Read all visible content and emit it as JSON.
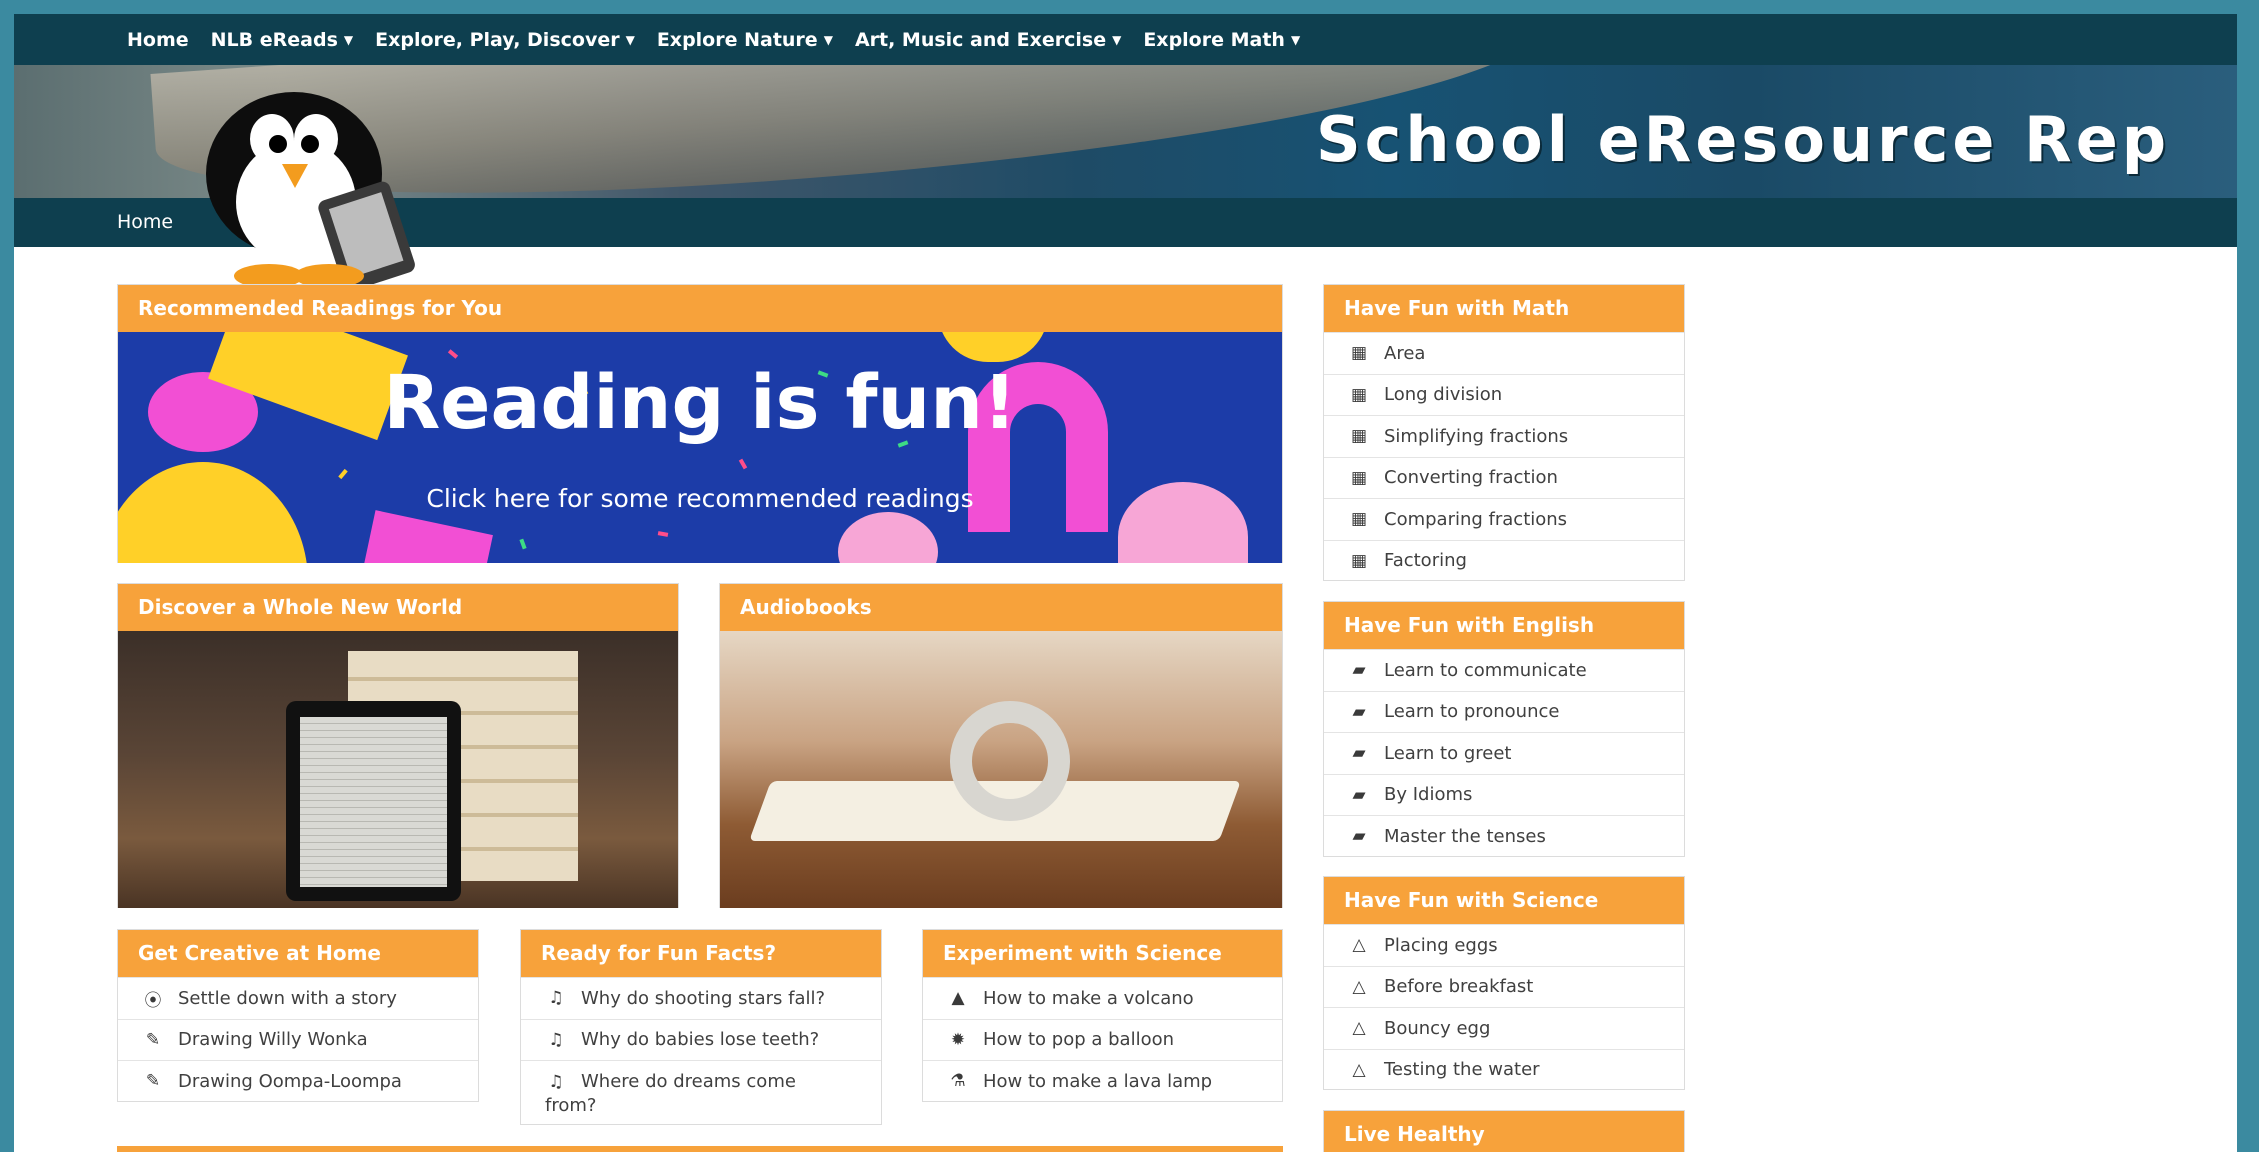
{
  "nav": {
    "items": [
      {
        "label": "Home",
        "dropdown": false
      },
      {
        "label": "NLB eReads",
        "dropdown": true
      },
      {
        "label": "Explore, Play, Discover",
        "dropdown": true
      },
      {
        "label": "Explore Nature",
        "dropdown": true
      },
      {
        "label": "Art, Music and Exercise",
        "dropdown": true
      },
      {
        "label": "Explore Math",
        "dropdown": true
      }
    ],
    "caret": "▼"
  },
  "banner": {
    "title": "School eResource Rep"
  },
  "breadcrumb": {
    "home": "Home"
  },
  "recommended": {
    "heading": "Recommended Readings for You",
    "banner_title": "Reading is fun!",
    "banner_sub": "Click here for some recommended readings"
  },
  "discover": {
    "heading": "Discover a Whole New World"
  },
  "audiobooks": {
    "heading": "Audiobooks"
  },
  "creative": {
    "heading": "Get Creative at Home",
    "items": [
      {
        "label": "Settle down with a story",
        "icon": "play-circle-icon",
        "glyph": "⦿"
      },
      {
        "label": "Drawing Willy Wonka",
        "icon": "pencil-icon",
        "glyph": "✎"
      },
      {
        "label": "Drawing Oompa-Loompa",
        "icon": "pencil-icon",
        "glyph": "✎"
      }
    ]
  },
  "facts": {
    "heading": "Ready for Fun Facts?",
    "items": [
      {
        "label": "Why do shooting stars fall?",
        "icon": "music-note-icon",
        "glyph": "♫"
      },
      {
        "label": "Why do babies lose teeth?",
        "icon": "music-note-icon",
        "glyph": "♫"
      },
      {
        "label": "Where do dreams come from?",
        "icon": "music-note-icon",
        "glyph": "♫"
      }
    ]
  },
  "experiment": {
    "heading": "Experiment with Science",
    "items": [
      {
        "label": "How to make a volcano",
        "icon": "warning-triangle-icon",
        "glyph": "▲"
      },
      {
        "label": "How to pop a balloon",
        "icon": "virus-icon",
        "glyph": "✹"
      },
      {
        "label": "How to make a lava lamp",
        "icon": "flask-icon",
        "glyph": "⚗"
      }
    ]
  },
  "math": {
    "heading": "Have Fun with Math",
    "items": [
      {
        "label": "Area"
      },
      {
        "label": "Long division"
      },
      {
        "label": "Simplifying fractions"
      },
      {
        "label": "Converting fraction"
      },
      {
        "label": "Comparing fractions"
      },
      {
        "label": "Factoring"
      }
    ],
    "icon": "calendar-x-icon",
    "glyph": "📅"
  },
  "english": {
    "heading": "Have Fun with English",
    "items": [
      {
        "label": "Learn to communicate"
      },
      {
        "label": "Learn to pronounce"
      },
      {
        "label": "Learn to greet"
      },
      {
        "label": "By Idioms"
      },
      {
        "label": "Master the tenses"
      }
    ],
    "icon": "book-icon",
    "glyph": "▰"
  },
  "science": {
    "heading": "Have Fun with Science",
    "items": [
      {
        "label": "Placing eggs"
      },
      {
        "label": "Before breakfast"
      },
      {
        "label": "Bouncy egg"
      },
      {
        "label": "Testing the water"
      }
    ],
    "icon": "flask-outline-icon",
    "glyph": "△"
  },
  "healthy": {
    "heading": "Live Healthy"
  },
  "colors": {
    "orange": "#f7a23b",
    "navy": "#0e3f4f",
    "frame": "#3b8aa0"
  }
}
